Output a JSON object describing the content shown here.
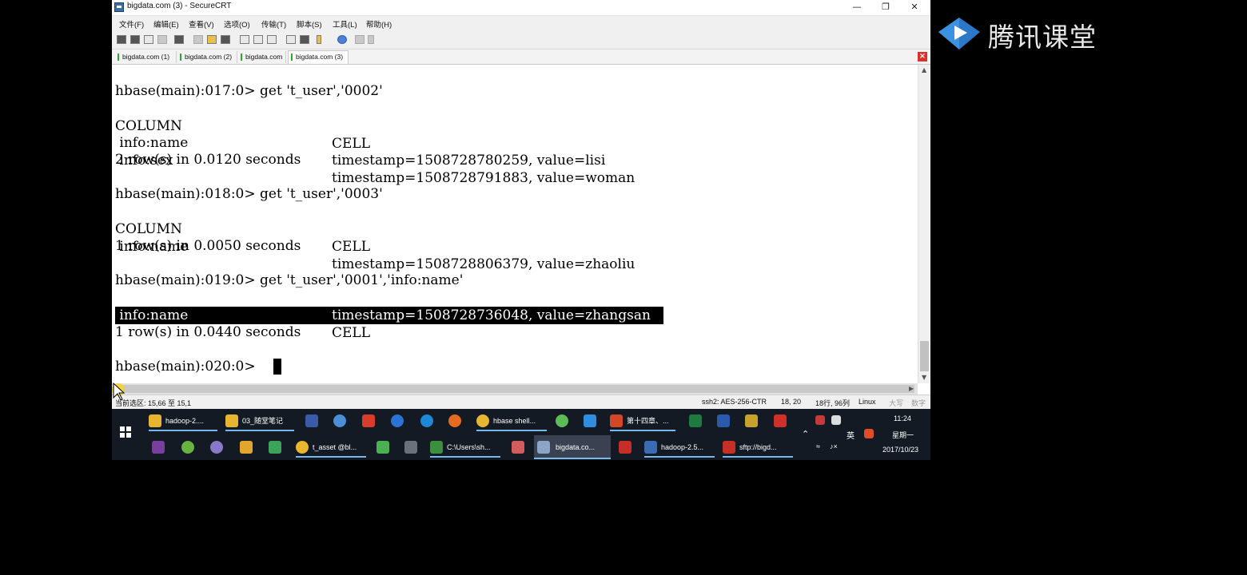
{
  "window": {
    "title": "bigdata.com (3) - SecureCRT"
  },
  "menu": [
    "文件(F)",
    "编辑(E)",
    "查看(V)",
    "选项(O)",
    "传输(T)",
    "脚本(S)",
    "工具(L)",
    "帮助(H)"
  ],
  "tabs": [
    "bigdata.com (1)",
    "bigdata.com (2)",
    "bigdata.com",
    "bigdata.com (3)"
  ],
  "terminal": {
    "prompt1": "hbase(main):017:0> get 't_user','0002'",
    "header_column": "COLUMN",
    "header_cell": "CELL",
    "r1a_col": " info:name",
    "r1a_cell": "timestamp=1508728780259, value=lisi",
    "r1b_col": " info:sex",
    "r1b_cell": "timestamp=1508728791883, value=woman",
    "summary1": "2 row(s) in 0.0120 seconds",
    "prompt2": "hbase(main):018:0> get 't_user','0003'",
    "r2a_col": " info:name",
    "r2a_cell": "timestamp=1508728806379, value=zhaoliu",
    "summary2": "1 row(s) in 0.0050 seconds",
    "prompt3": "hbase(main):019:0> get 't_user','0001','info:name'",
    "r3a_col": " info:name",
    "r3a_cell": "timestamp=1508728736048, value=zhangsan",
    "summary3": "1 row(s) in 0.0440 seconds",
    "prompt4": "hbase(main):020:0> "
  },
  "status": {
    "selection": "当前选区: 15,66 至 15,1",
    "protocol": "ssh2: AES-256-CTR",
    "position": "18,  20",
    "size": "18行, 96列",
    "os": "Linux",
    "caps": "大写",
    "num": "数字"
  },
  "taskbar": {
    "row1": [
      "hadoop-2....",
      "03_随堂笔记",
      "hbase shell..."
    ],
    "row2": [
      "t_asset @bl...",
      "C:\\Users\\sh...",
      "bigdata.co...",
      "hadoop-2.5...",
      "sftp://bigd..."
    ],
    "row1_extra": "第十四章、...",
    "ime": "英",
    "time": "11:24",
    "weekday": "星期一",
    "date": "2017/10/23"
  },
  "logo": {
    "text": "腾讯课堂"
  }
}
